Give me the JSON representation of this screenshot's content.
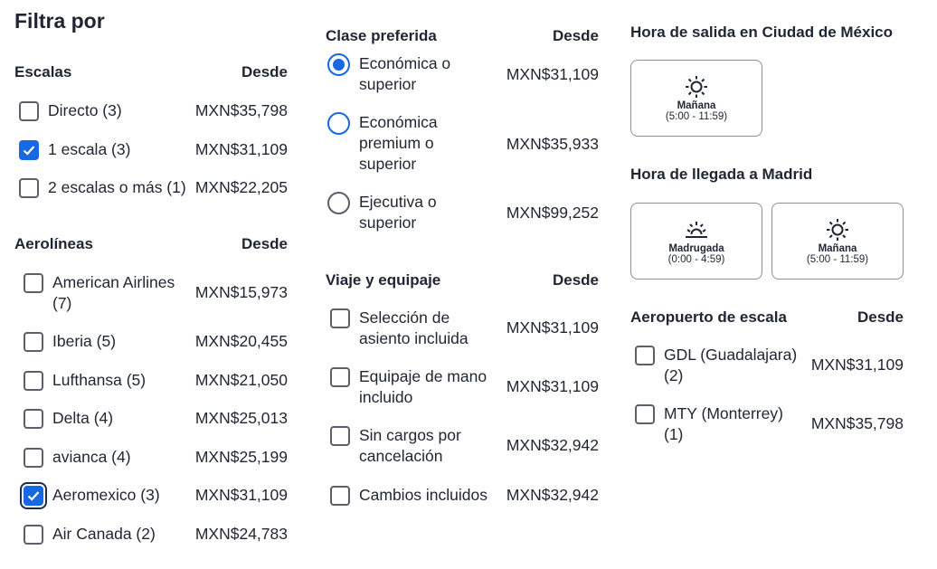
{
  "title": "Filtra por",
  "desde": "Desde",
  "escalas": {
    "heading": "Escalas",
    "items": [
      {
        "label": "Directo (3)",
        "price": "MXN$35,798",
        "checked": false
      },
      {
        "label": "1 escala (3)",
        "price": "MXN$31,109",
        "checked": true
      },
      {
        "label": "2 escalas o más (1)",
        "price": "MXN$22,205",
        "checked": false
      }
    ]
  },
  "aerolineas": {
    "heading": "Aerolíneas",
    "items": [
      {
        "label": "American Airlines (7)",
        "price": "MXN$15,973",
        "checked": false
      },
      {
        "label": "Iberia (5)",
        "price": "MXN$20,455",
        "checked": false
      },
      {
        "label": "Lufthansa (5)",
        "price": "MXN$21,050",
        "checked": false
      },
      {
        "label": "Delta (4)",
        "price": "MXN$25,013",
        "checked": false
      },
      {
        "label": "avianca (4)",
        "price": "MXN$25,199",
        "checked": false
      },
      {
        "label": "Aeromexico (3)",
        "price": "MXN$31,109",
        "checked": true
      },
      {
        "label": "Air Canada (2)",
        "price": "MXN$24,783",
        "checked": false
      }
    ]
  },
  "clase": {
    "heading": "Clase preferida",
    "items": [
      {
        "label": "Económica o superior",
        "price": "MXN$31,109",
        "selected": true
      },
      {
        "label": "Económica premium o superior",
        "price": "MXN$35,933",
        "selected": false
      },
      {
        "label": "Ejecutiva o superior",
        "price": "MXN$99,252",
        "selected": false
      }
    ]
  },
  "equipaje": {
    "heading": "Viaje y equipaje",
    "items": [
      {
        "label": "Selección de asiento incluida",
        "price": "MXN$31,109"
      },
      {
        "label": "Equipaje de mano incluido",
        "price": "MXN$31,109"
      },
      {
        "label": "Sin cargos por cancelación",
        "price": "MXN$32,942"
      },
      {
        "label": "Cambios incluidos",
        "price": "MXN$32,942"
      }
    ]
  },
  "salida": {
    "heading": "Hora de salida en Ciudad de México",
    "cards": [
      {
        "label": "Mañana",
        "range": "(5:00 - 11:59)",
        "icon": "sun-icon"
      }
    ]
  },
  "llegada": {
    "heading": "Hora de llegada a Madrid",
    "cards": [
      {
        "label": "Madrugada",
        "range": "(0:00 - 4:59)",
        "icon": "sunrise-icon"
      },
      {
        "label": "Mañana",
        "range": "(5:00 - 11:59)",
        "icon": "sun-icon"
      }
    ]
  },
  "aeropuerto": {
    "heading": "Aeropuerto de escala",
    "items": [
      {
        "label": "GDL (Guadalajara) (2)",
        "price": "MXN$31,109"
      },
      {
        "label": "MTY (Monterrey) (1)",
        "price": "MXN$35,798"
      }
    ]
  },
  "colors": {
    "accent": "#1668e3",
    "text": "#1f2532",
    "border": "#5a5f6b"
  }
}
